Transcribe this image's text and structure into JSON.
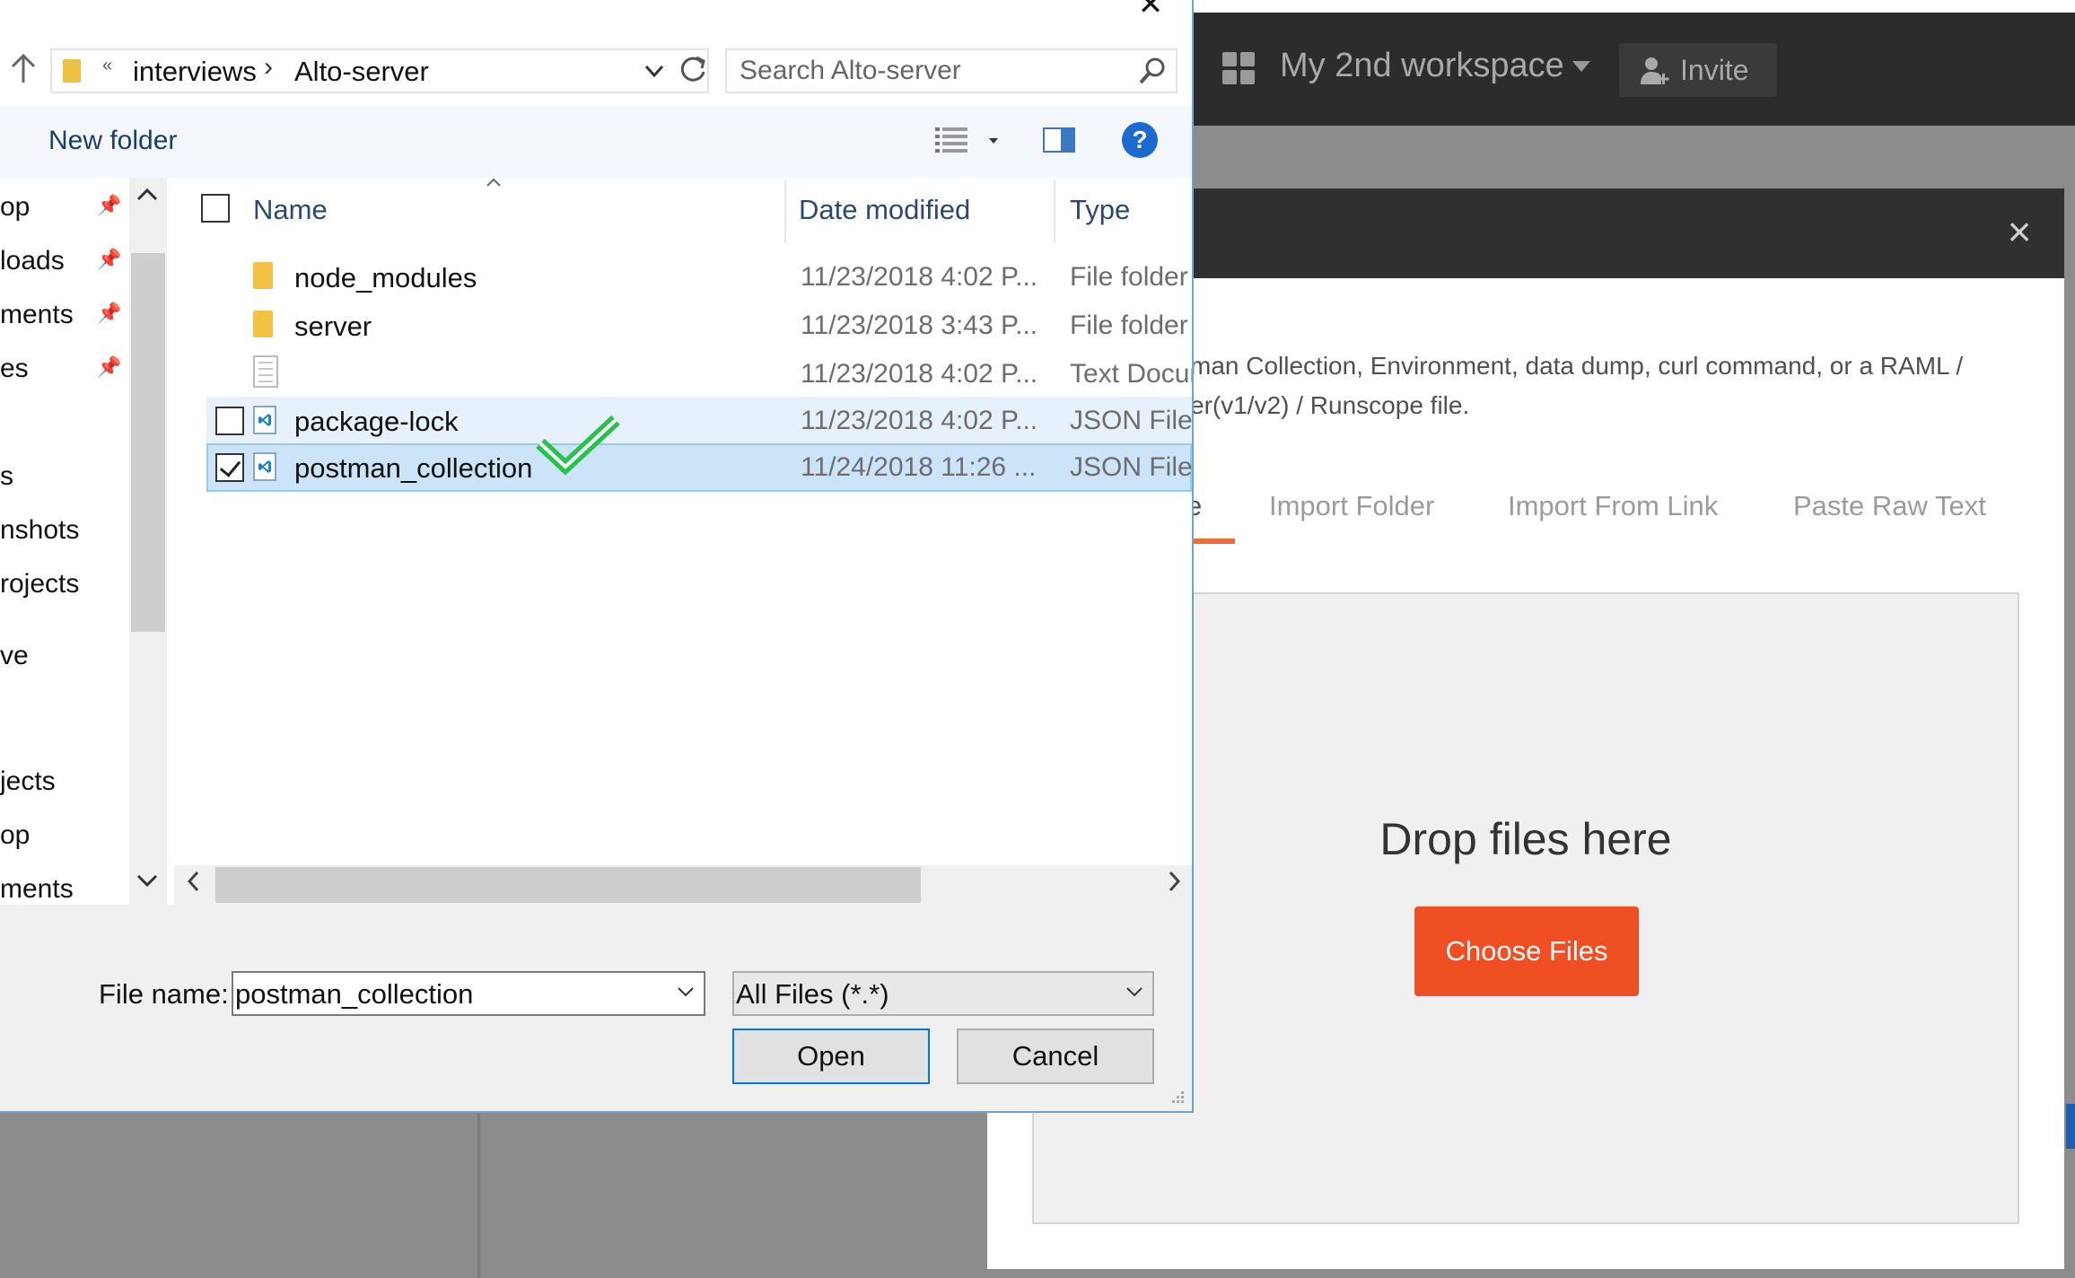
{
  "postman": {
    "workspace_name": "My 2nd workspace",
    "invite_label": "Invite",
    "modal": {
      "description_line1": "man Collection, Environment, data dump, curl command, or a RAML /",
      "description_line2": "er(v1/v2) / Runscope file.",
      "tabs": [
        "e",
        "Import Folder",
        "Import From Link",
        "Paste Raw Text"
      ],
      "drop_text": "Drop files here",
      "choose_files_label": "Choose Files",
      "close_glyph": "×"
    },
    "colors": {
      "accent": "#f04e23",
      "tab_underline": "#f26b3a",
      "topbar": "#2c2c2c"
    }
  },
  "dialog": {
    "close_glyph": "✕",
    "address": {
      "overflow": "«",
      "parts": [
        "interviews",
        "Alto-server"
      ],
      "separator": "›"
    },
    "search_placeholder": "Search Alto-server",
    "new_folder_label": "New folder",
    "help_glyph": "?",
    "nav_items": [
      "op",
      "loads",
      "ments",
      "es",
      "s",
      "nshots",
      "rojects",
      "ve",
      "jects",
      "op",
      "ments"
    ],
    "columns": {
      "name": "Name",
      "date": "Date modified",
      "type": "Type"
    },
    "files": [
      {
        "name": "node_modules",
        "date": "11/23/2018 4:02 P...",
        "type": "File folder",
        "icon": "folder-icon",
        "checked": false
      },
      {
        "name": "server",
        "date": "11/23/2018 3:43 P...",
        "type": "File folder",
        "icon": "folder-icon",
        "checked": false
      },
      {
        "name": "",
        "date": "11/23/2018 4:02 P...",
        "type": "Text Docum",
        "icon": "text-file-icon",
        "checked": false
      },
      {
        "name": "package-lock",
        "date": "11/23/2018 4:02 P...",
        "type": "JSON File",
        "icon": "vscode-json-icon",
        "checked": false
      },
      {
        "name": "postman_collection",
        "date": "11/24/2018 11:26 ...",
        "type": "JSON File",
        "icon": "vscode-json-icon",
        "checked": true
      }
    ],
    "file_name_label": "File name:",
    "file_name_value": "postman_collection",
    "file_type_value": "All Files (*.*)",
    "open_label": "Open",
    "cancel_label": "Cancel"
  }
}
